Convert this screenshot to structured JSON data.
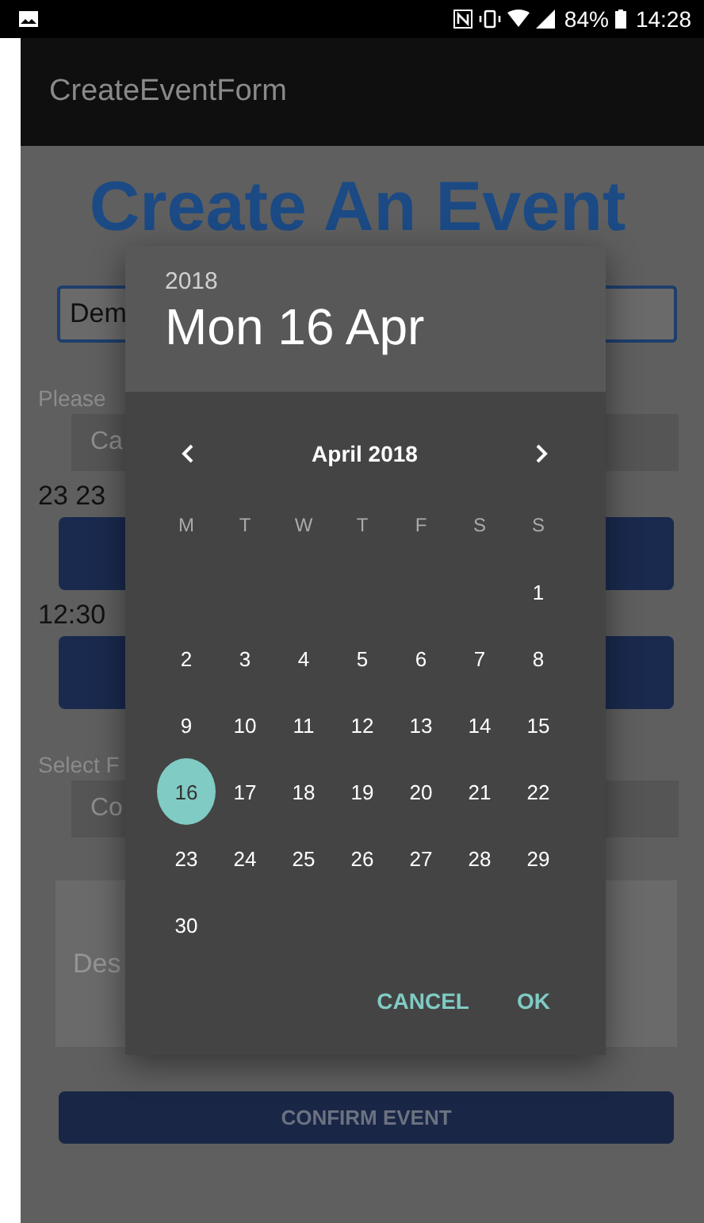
{
  "status_bar": {
    "battery": "84%",
    "time": "14:28"
  },
  "app_bar": {
    "title": "CreateEventForm"
  },
  "form": {
    "heading": "Create An Event",
    "name_field": {
      "value": "Dem"
    },
    "category_label": "Please",
    "category_button": "Ca",
    "date_text": "23 23",
    "time_text": "12:30",
    "frequency_label": "Select F",
    "frequency_button": "Co",
    "description_field": {
      "placeholder": "Des"
    },
    "confirm_button": "CONFIRM EVENT"
  },
  "date_picker": {
    "year": "2018",
    "date": "Mon 16 Apr",
    "month": "April 2018",
    "weekdays": [
      "M",
      "T",
      "W",
      "T",
      "F",
      "S",
      "S"
    ],
    "weeks": [
      {
        "kind": "first",
        "days": [
          {
            "label": "1",
            "selected": false
          }
        ]
      },
      {
        "kind": "regular",
        "days": [
          {
            "label": "2",
            "selected": false
          },
          {
            "label": "3",
            "selected": false
          },
          {
            "label": "4",
            "selected": false
          },
          {
            "label": "5",
            "selected": false
          },
          {
            "label": "6",
            "selected": false
          },
          {
            "label": "7",
            "selected": false
          },
          {
            "label": "8",
            "selected": false
          }
        ]
      },
      {
        "kind": "regular",
        "days": [
          {
            "label": "9",
            "selected": false
          },
          {
            "label": "10",
            "selected": false
          },
          {
            "label": "11",
            "selected": false
          },
          {
            "label": "12",
            "selected": false
          },
          {
            "label": "13",
            "selected": false
          },
          {
            "label": "14",
            "selected": false
          },
          {
            "label": "15",
            "selected": false
          }
        ]
      },
      {
        "kind": "regular",
        "days": [
          {
            "label": "16",
            "selected": true
          },
          {
            "label": "17",
            "selected": false
          },
          {
            "label": "18",
            "selected": false
          },
          {
            "label": "19",
            "selected": false
          },
          {
            "label": "20",
            "selected": false
          },
          {
            "label": "21",
            "selected": false
          },
          {
            "label": "22",
            "selected": false
          }
        ]
      },
      {
        "kind": "regular",
        "days": [
          {
            "label": "23",
            "selected": false
          },
          {
            "label": "24",
            "selected": false
          },
          {
            "label": "25",
            "selected": false
          },
          {
            "label": "26",
            "selected": false
          },
          {
            "label": "27",
            "selected": false
          },
          {
            "label": "28",
            "selected": false
          },
          {
            "label": "29",
            "selected": false
          }
        ]
      },
      {
        "kind": "regular",
        "days": [
          {
            "label": "30",
            "selected": false
          }
        ]
      }
    ],
    "buttons": [
      "CANCEL",
      "OK"
    ]
  }
}
